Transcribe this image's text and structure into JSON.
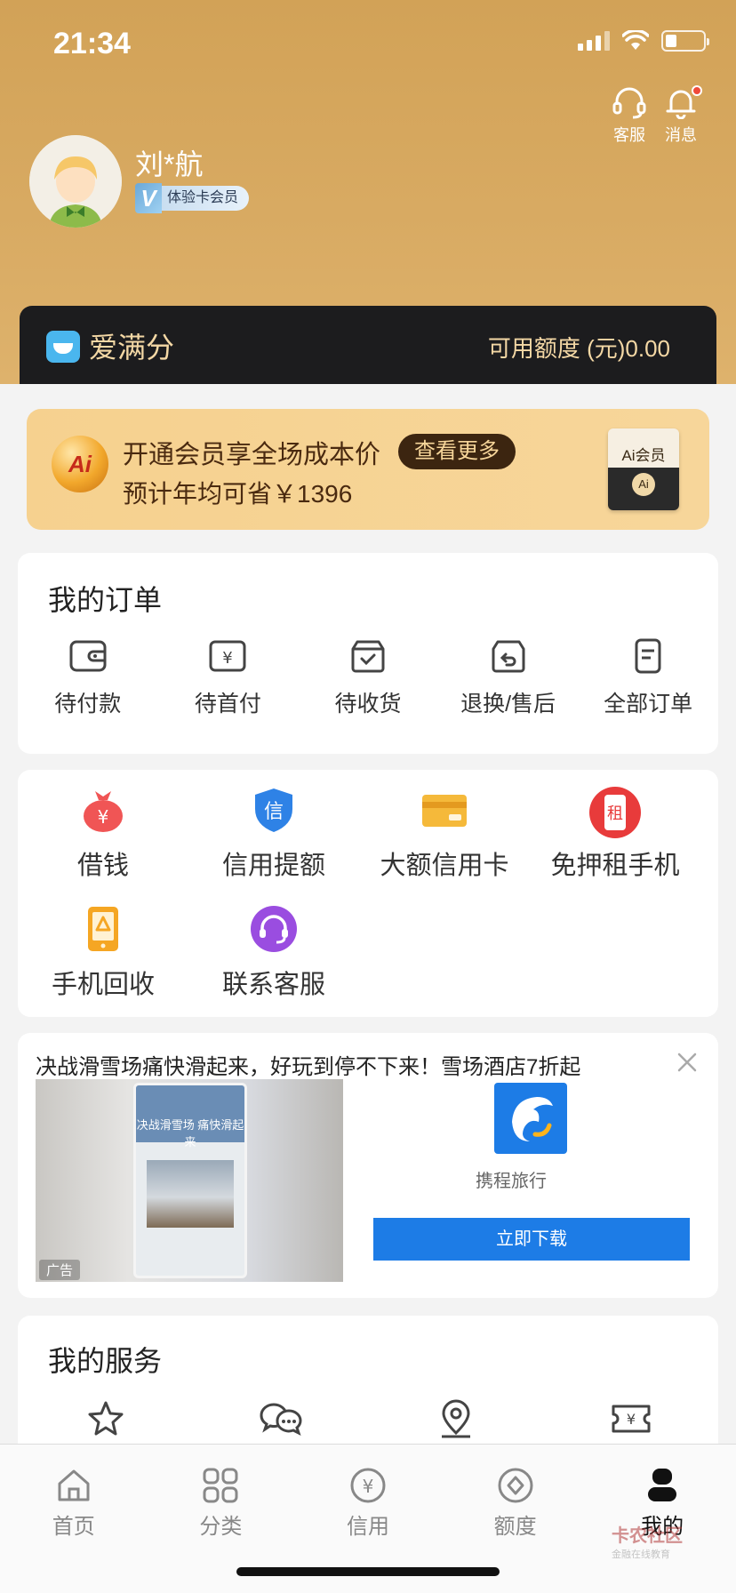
{
  "status_bar": {
    "time": "21:34"
  },
  "header": {
    "service_label": "客服",
    "message_label": "消息",
    "username": "刘*航",
    "member_badge": "体验卡会员"
  },
  "limit": {
    "title": "爱满分",
    "amount_label": "可用额度 (元)0.00"
  },
  "vip_banner": {
    "line1": "开通会员享全场成本价",
    "more_button": "查看更多",
    "line2": "预计年均可省￥1396",
    "card_label": "Ai会员",
    "card_chip": "Ai",
    "badge_text": "Ai"
  },
  "orders": {
    "title": "我的订单",
    "items": [
      {
        "label": "待付款",
        "icon": "wallet-icon"
      },
      {
        "label": "待首付",
        "icon": "yuan-receipt-icon"
      },
      {
        "label": "待收货",
        "icon": "box-check-icon"
      },
      {
        "label": "退换/售后",
        "icon": "return-icon"
      },
      {
        "label": "全部订单",
        "icon": "document-icon"
      }
    ]
  },
  "tools": {
    "items": [
      {
        "label": "借钱",
        "icon": "money-bag-icon"
      },
      {
        "label": "信用提额",
        "icon": "credit-shield-icon"
      },
      {
        "label": "大额信用卡",
        "icon": "credit-card-icon"
      },
      {
        "label": "免押租手机",
        "icon": "rent-phone-icon",
        "glyph": "租"
      },
      {
        "label": "手机回收",
        "icon": "phone-recycle-icon"
      },
      {
        "label": "联系客服",
        "icon": "headset-icon"
      }
    ],
    "credit_glyph": "信",
    "money_glyph": "¥"
  },
  "ad": {
    "title": "决战滑雪场痛快滑起来，好玩到停不下来！雪场酒店7折起",
    "image_caption": "决战滑雪场 痛快滑起来",
    "ad_tag": "广告",
    "app_name": "携程旅行",
    "download_button": "立即下载"
  },
  "services": {
    "title": "我的服务",
    "icons": [
      "star-icon",
      "chat-icon",
      "location-icon",
      "ticket-icon"
    ]
  },
  "tabbar": {
    "tabs": [
      {
        "label": "首页",
        "icon": "home-icon",
        "active": false
      },
      {
        "label": "分类",
        "icon": "category-icon",
        "active": false
      },
      {
        "label": "信用",
        "icon": "credit-icon",
        "active": false
      },
      {
        "label": "额度",
        "icon": "quota-icon",
        "active": false
      },
      {
        "label": "我的",
        "icon": "profile-icon",
        "active": true
      }
    ],
    "watermark_title": "卡农社区",
    "watermark_sub": "金融在线教育"
  },
  "colors": {
    "header_gold": "#d2a257",
    "limit_bar": "#1c1c1e",
    "limit_text": "#f4d8a5",
    "ad_blue": "#1d7ce6",
    "notification_dot": "#f04a3a"
  }
}
